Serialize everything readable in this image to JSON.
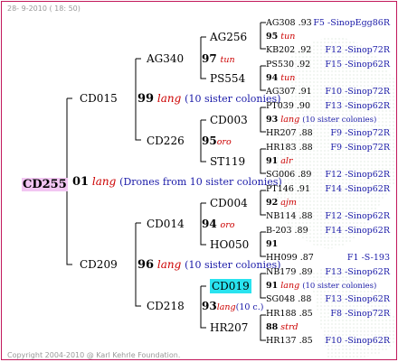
{
  "header": {
    "date": "28-  9-2010 ( 18: 50)"
  },
  "root": {
    "name": "CD255",
    "year": "01",
    "breeder": "lang",
    "note": "(Drones from 10 sister colonies)"
  },
  "gen1": [
    {
      "name": "CD015",
      "year": "99",
      "breeder": "lang",
      "note": "(10 sister colonies)"
    },
    {
      "name": "CD209",
      "year": "96",
      "breeder": "lang",
      "note": "(10 sister colonies)"
    }
  ],
  "gen2": [
    {
      "name": "AG340",
      "year": "97",
      "breeder": "tun"
    },
    {
      "name": "CD226",
      "year": "95",
      "breeder": "oro"
    },
    {
      "name": "CD014",
      "year": "94",
      "breeder": "oro"
    },
    {
      "name": "CD218",
      "year": "93",
      "breeder": "lang",
      "note": "(10 c.)"
    }
  ],
  "gen3": [
    {
      "name": "AG256"
    },
    {
      "name": "PS554"
    },
    {
      "name": "CD003"
    },
    {
      "name": "ST119"
    },
    {
      "name": "CD004"
    },
    {
      "name": "HO050"
    },
    {
      "name": "CD019"
    },
    {
      "name": "HR207"
    }
  ],
  "gen4": [
    {
      "left": "AG308 .93",
      "right": "F5 -SinopEgg86R"
    },
    {
      "year": "95",
      "breeder": "tun"
    },
    {
      "left": "KB202 .92",
      "right": "F12 -Sinop72R"
    },
    {
      "left": "PS530 .92",
      "right": "F15 -Sinop62R"
    },
    {
      "year": "94",
      "breeder": "tun"
    },
    {
      "left": "AG307 .91",
      "right": "F10 -Sinop72R"
    },
    {
      "left": "PT039 .90",
      "right": "F13 -Sinop62R"
    },
    {
      "year": "93",
      "breeder": "lang",
      "note": "(10 sister colonies)"
    },
    {
      "left": "HR207 .88",
      "right": "F9 -Sinop72R"
    },
    {
      "left": "HR183 .88",
      "right": "F9 -Sinop72R"
    },
    {
      "year": "91",
      "breeder": "alr"
    },
    {
      "left": "SG006 .89",
      "right": "F12 -Sinop62R"
    },
    {
      "left": "PT146 .91",
      "right": "F14 -Sinop62R"
    },
    {
      "year": "92",
      "breeder": "ajm"
    },
    {
      "left": "NB114 .88",
      "right": "F12 -Sinop62R"
    },
    {
      "left": "B-203 .89",
      "right": "F14 -Sinop62R"
    },
    {
      "year": "91"
    },
    {
      "left": "HH099 .87",
      "right": "F1 -S-193"
    },
    {
      "left": "NB179 .89",
      "right": "F13 -Sinop62R"
    },
    {
      "year": "91",
      "breeder": "lang",
      "note": "(10 sister colonies)"
    },
    {
      "left": "SG048 .88",
      "right": "F13 -Sinop62R"
    },
    {
      "left": "HR188 .85",
      "right": "F8 -Sinop72R"
    },
    {
      "year": "88",
      "breeder": "strd"
    },
    {
      "left": "HR137 .85",
      "right": "F10 -Sinop62R"
    }
  ],
  "footer": {
    "copyright": "Copyright 2004-2010 @ Karl Kehrle Foundation."
  }
}
